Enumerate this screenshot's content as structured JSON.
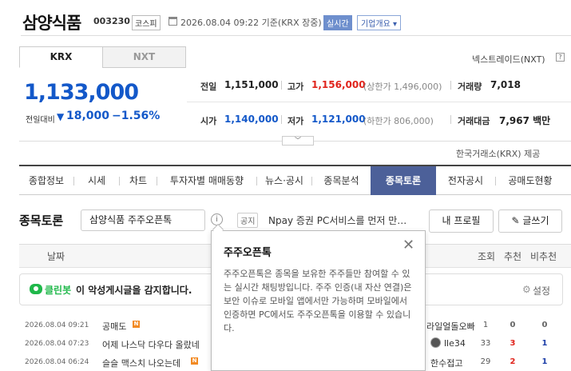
{
  "header": {
    "title": "삼양식품",
    "code": "003230",
    "market": "코스피",
    "datetime": "2026.08.04 09:22 기준(KRX 장중)",
    "realtime": "실시간",
    "company_info": "기업개요"
  },
  "exchange": {
    "tabs": [
      "KRX",
      "NXT"
    ],
    "nextrade_label": "넥스트레이드(NXT)",
    "source": "한국거래소(KRX) 제공"
  },
  "quote": {
    "price": "1,133,000",
    "change_label": "전일대비",
    "change_value": "18,000",
    "change_pct": "−1.56%",
    "prev_close_label": "전일",
    "prev_close": "1,151,000",
    "high_label": "고가",
    "high": "1,156,000",
    "upper_limit": "(상한가 1,496,000)",
    "volume_label": "거래량",
    "volume": "7,018",
    "open_label": "시가",
    "open": "1,140,000",
    "low_label": "저가",
    "low": "1,121,000",
    "lower_limit": "(하한가 806,000)",
    "amount_label": "거래대금",
    "amount": "7,967 백만"
  },
  "nav": {
    "items": [
      "종합정보",
      "시세",
      "차트",
      "투자자별 매매동향",
      "뉴스·공시",
      "종목분석",
      "종목토론",
      "전자공시",
      "공매도현황"
    ]
  },
  "board": {
    "title": "종목토론",
    "room_button": "삼양식품 주주오픈톡",
    "notice_badge": "공지",
    "notice_text": "Npay 증권 PC서비스를 먼저 만…",
    "profile_button": "내 프로필",
    "write_button": "글쓰기",
    "columns": {
      "date": "날짜",
      "views": "조회",
      "likes": "추천",
      "dislikes": "비추천"
    },
    "cleanbot_name": "클린봇",
    "cleanbot_text": "이 악성게시글을 감지합니다.",
    "settings": "설정",
    "rows": [
      {
        "date": "2026.08.04 09:21",
        "title": "공매도",
        "author": "라일얼돌오빠",
        "views": "1",
        "likes": "0",
        "dislikes": "0"
      },
      {
        "date": "2026.08.04 07:23",
        "title": "어제 나스닥 다우다 올랐네",
        "author": "lle34",
        "views": "33",
        "likes": "3",
        "dislikes": "1"
      },
      {
        "date": "2026.08.04 06:24",
        "title": "슬슬 맥스치 나오는데",
        "author": "한수접고",
        "views": "29",
        "likes": "2",
        "dislikes": "1"
      }
    ],
    "new_badge": "N"
  },
  "popover": {
    "title": "주주오픈톡",
    "body": "주주오픈톡은 종목을 보유한 주주들만 참여할 수 있는 실시간 채팅방입니다. 주주 인증(내 자산 연결)은 보안 이슈로 모바일 앱에서만 가능하며 모바일에서 인증하면 PC에서도 주주오픈톡을 이용할 수 있습니다."
  }
}
